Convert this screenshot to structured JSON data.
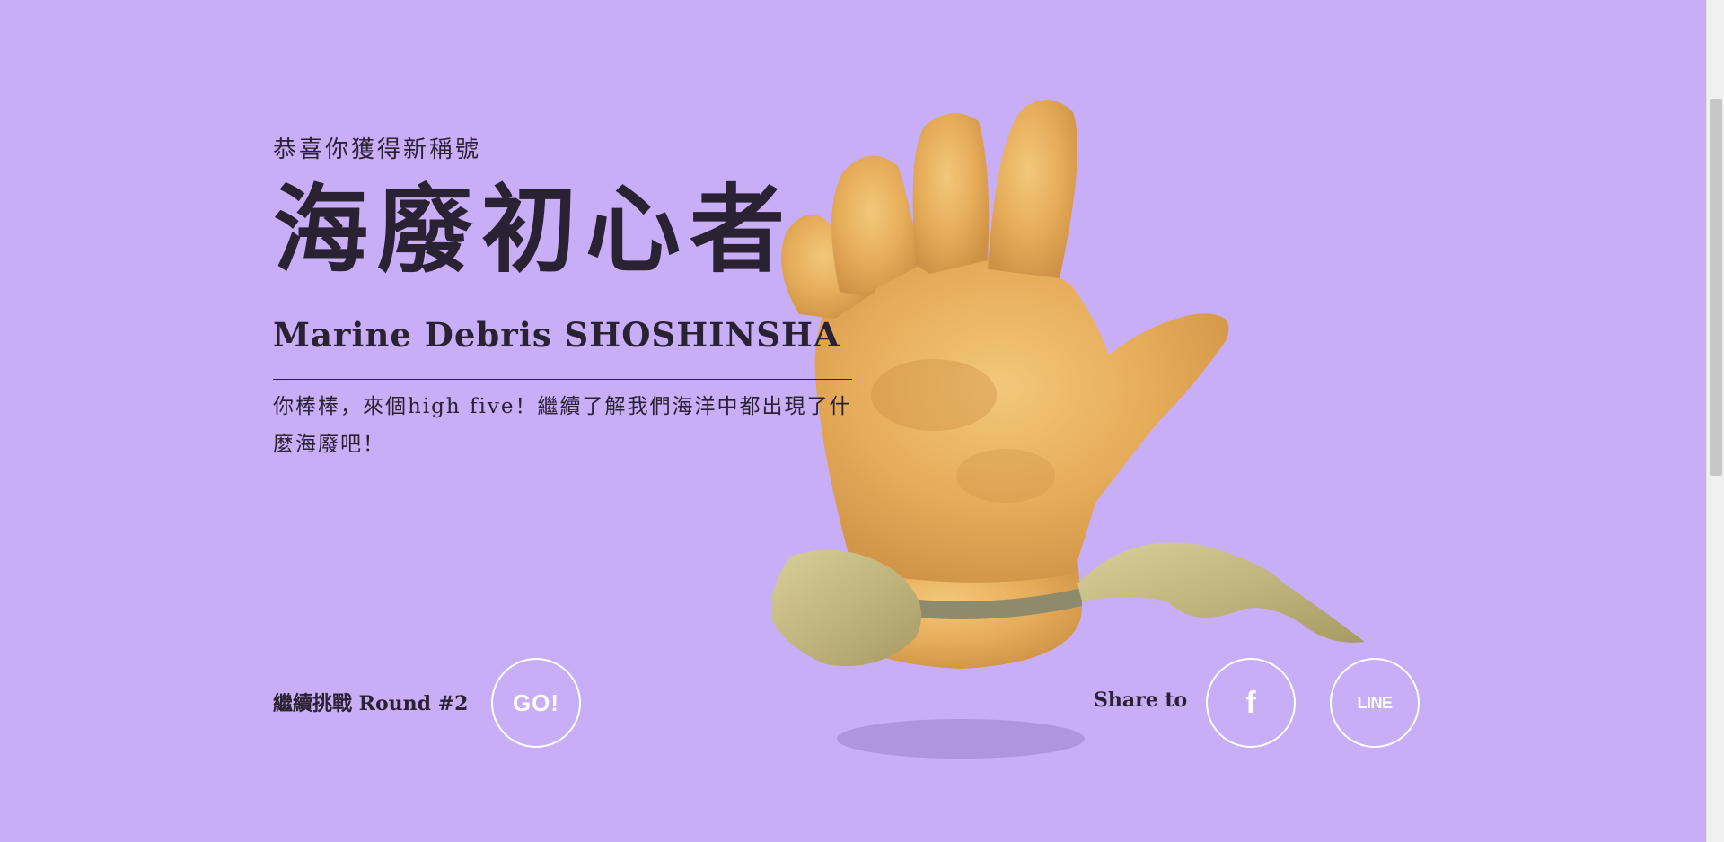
{
  "result": {
    "subtitle": "恭喜你獲得新稱號",
    "title_zh": "海廢初心者",
    "title_en": "Marine Debris SHOSHINSHA",
    "description": "你棒棒，來個high five！繼續了解我們海洋中都出現了什麼海廢吧！"
  },
  "actions": {
    "next_round_label": "繼續挑戰 Round #2",
    "go_label": "GO!",
    "share_label": "Share to",
    "facebook_label": "f",
    "line_label": "LINE"
  },
  "illustration": {
    "subject": "doll-hand-marine-debris",
    "colors": {
      "background": "#c8aef7",
      "hand": "#e8b45f",
      "cloth": "#c7be86",
      "shadow": "#a98fd8"
    }
  }
}
